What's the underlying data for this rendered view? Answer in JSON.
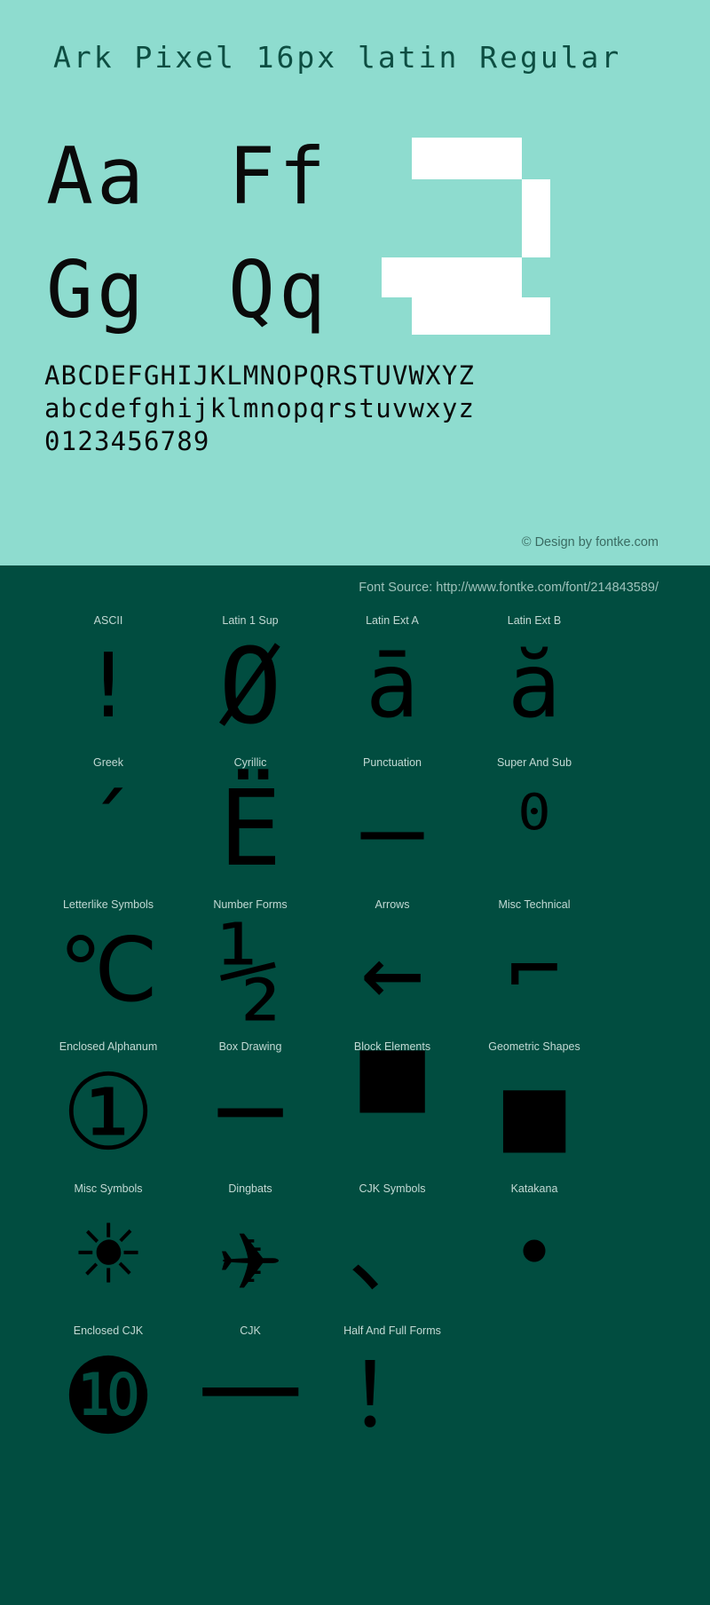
{
  "theme": {
    "light_bg": "#8edccf",
    "dark_bg": "#014d40",
    "glyph_black": "#000000",
    "glyph_white": "#ffffff",
    "label_color": "#c2d9d4",
    "title_color": "#0d4e42"
  },
  "header": {
    "font_title": "Ark Pixel 16px latin Regular"
  },
  "samples": {
    "pairs": [
      "Aa",
      "Ff",
      "Gg",
      "Qq"
    ],
    "showcase_glyph": "a"
  },
  "alphabet": {
    "uppercase": "ABCDEFGHIJKLMNOPQRSTUVWXYZ",
    "lowercase": "abcdefghijklmnopqrstuvwxyz",
    "digits": "0123456789"
  },
  "credits": {
    "copyright": "© Design by fontke.com",
    "font_source": "Font Source: http://www.fontke.com/font/214843589/"
  },
  "ranges": [
    [
      {
        "label": "ASCII",
        "glyph": "!",
        "size": "g-lg"
      },
      {
        "label": "Latin 1 Sup",
        "glyph": "Ø",
        "size": "g-xl"
      },
      {
        "label": "Latin Ext A",
        "glyph": "ā",
        "size": "g-lg"
      },
      {
        "label": "Latin Ext B",
        "glyph": "ă",
        "size": "g-lg"
      }
    ],
    [
      {
        "label": "Greek",
        "glyph": "΄",
        "size": "g-lg"
      },
      {
        "label": "Cyrillic",
        "glyph": "Ё",
        "size": "g-xl"
      },
      {
        "label": "Punctuation",
        "glyph": "—",
        "size": "g-xl"
      },
      {
        "label": "Super And Sub",
        "glyph": "⁰",
        "size": "g-lg"
      }
    ],
    [
      {
        "label": "Letterlike Symbols",
        "glyph": "℃",
        "size": "g-lg"
      },
      {
        "label": "Number Forms",
        "glyph": "½",
        "size": "g-xl"
      },
      {
        "label": "Arrows",
        "glyph": "←",
        "size": "g-xl"
      },
      {
        "label": "Misc Technical",
        "glyph": "⌐",
        "size": "g-lg"
      }
    ],
    [
      {
        "label": "Enclosed Alphanum",
        "glyph": "①",
        "size": "g-xl"
      },
      {
        "label": "Box Drawing",
        "glyph": "─",
        "size": "g-xl"
      },
      {
        "label": "Block Elements",
        "glyph": "▀",
        "size": "g-xl"
      },
      {
        "label": "Geometric Shapes",
        "glyph": "■",
        "size": "g-xl"
      }
    ],
    [
      {
        "label": "Misc Symbols",
        "glyph": "☀",
        "size": "g-xl"
      },
      {
        "label": "Dingbats",
        "glyph": "✈",
        "size": "g-xl"
      },
      {
        "label": "CJK Symbols",
        "glyph": "、",
        "size": "g-lg"
      },
      {
        "label": "Katakana",
        "glyph": "・",
        "size": "g-xl"
      }
    ],
    [
      {
        "label": "Enclosed CJK",
        "glyph": "❿",
        "size": "g-xl"
      },
      {
        "label": "CJK",
        "glyph": "一",
        "size": "g-xl"
      },
      {
        "label": "Half And Full Forms",
        "glyph": "！",
        "size": "g-lg"
      },
      {
        "label": "",
        "glyph": "",
        "size": "g-lg"
      }
    ]
  ]
}
